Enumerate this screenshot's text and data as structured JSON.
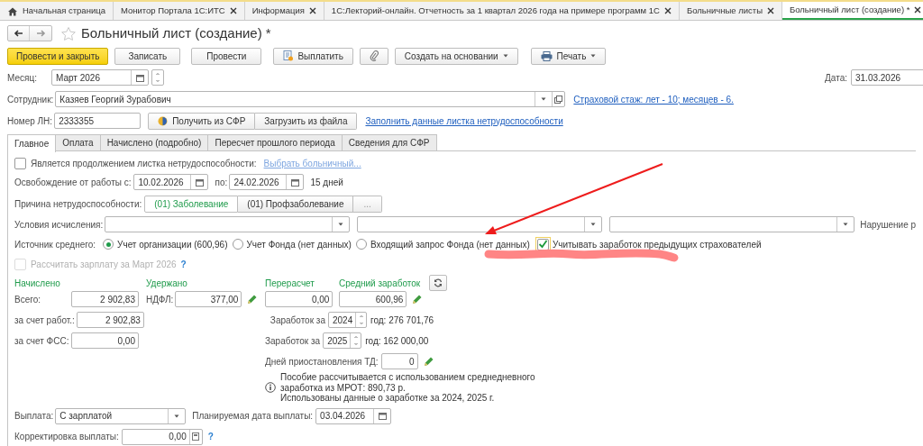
{
  "open_tabs": [
    {
      "kind": "home",
      "label": "Начальная страница",
      "closable": false,
      "selected": false
    },
    {
      "kind": "doc",
      "label": "Монитор Портала 1С:ИТС",
      "closable": true,
      "selected": false
    },
    {
      "kind": "doc",
      "label": "Информация",
      "closable": true,
      "selected": false
    },
    {
      "kind": "doc",
      "label": "1С:Лекторий-онлайн. Отчетность за 1 квартал 2026 года на примере программ 1С",
      "closable": true,
      "selected": false
    },
    {
      "kind": "doc",
      "label": "Больничные листы",
      "closable": true,
      "selected": false
    },
    {
      "kind": "doc",
      "label": "Больничный лист (создание) *",
      "closable": true,
      "selected": true
    }
  ],
  "title": "Больничный лист (создание) *",
  "toolbar": [
    {
      "kind": "primary",
      "label": "Провести и закрыть"
    },
    {
      "kind": "plain",
      "label": "Записать"
    },
    {
      "kind": "plain",
      "label": "Провести"
    },
    {
      "kind": "pay",
      "label": "Выплатить"
    },
    {
      "kind": "attach"
    },
    {
      "kind": "menu",
      "label": "Создать на основании"
    },
    {
      "kind": "print",
      "label": "Печать"
    }
  ],
  "month": {
    "label": "Месяц:",
    "value": "Март 2026"
  },
  "date": {
    "label": "Дата:",
    "value": "31.03.2026"
  },
  "employee": {
    "label": "Сотрудник:",
    "value": "Казяев Георгий Зурабович",
    "link": "Страховой стаж: лет - 10; месяцев - 6."
  },
  "sick_leave_number": {
    "label": "Номер ЛН:",
    "value": "2333355",
    "buttons": [
      {
        "kind": "sfr",
        "label": "Получить из СФР"
      },
      {
        "kind": "plain",
        "label": "Загрузить из файла"
      }
    ],
    "link": "Заполнить данные листка нетрудоспособности"
  },
  "form_tabs": [
    {
      "label": "Главное",
      "selected": true
    },
    {
      "label": "Оплата",
      "selected": false
    },
    {
      "label": "Начислено (подробно)",
      "selected": false
    },
    {
      "label": "Пересчет прошлого периода",
      "selected": false
    },
    {
      "label": "Сведения для СФР",
      "selected": false
    }
  ],
  "continuation": {
    "label": "Является продолжением листка нетрудоспособности:",
    "checked": false,
    "link": "Выбрать больничный..."
  },
  "release": {
    "label": "Освобождение от работы с:",
    "from": "10.02.2026",
    "to_label": "по:",
    "to": "24.02.2026",
    "duration": "15 дней"
  },
  "reason": {
    "label": "Причина нетрудоспособности:",
    "options": [
      {
        "label": "(01) Заболевание",
        "selected": true
      },
      {
        "label": "(01) Профзаболевание",
        "selected": false
      }
    ],
    "more": "..."
  },
  "conditions": {
    "label": "Условия исчисления:",
    "violation_label": "Нарушение р"
  },
  "average_source": {
    "label": "Источник среднего:",
    "options": [
      {
        "label": "Учет организации (600,96)",
        "selected": true
      },
      {
        "label": "Учет Фонда (нет данных)",
        "selected": false
      },
      {
        "label": "Входящий запрос Фонда (нет данных)",
        "selected": false
      }
    ]
  },
  "previous_insurers": {
    "label": "Учитывать заработок предыдущих страхователей",
    "checked": true,
    "focused": true
  },
  "recalc_salary": {
    "label": "Рассчитать зарплату за Март 2026",
    "checked": false,
    "disabled": true,
    "help": "?"
  },
  "accrued": {
    "title": "Начислено",
    "rows": [
      {
        "label": "Всего:",
        "value": "2 902,83"
      },
      {
        "label": "за счет работ.:",
        "value": "2 902,83"
      },
      {
        "label": "за счет ФСС:",
        "value": "0,00"
      }
    ]
  },
  "withheld": {
    "title": "Удержано",
    "label": "НДФЛ:",
    "value": "377,00"
  },
  "recalculation": {
    "title": "Перерасчет",
    "value": "0,00"
  },
  "average_earnings": {
    "title": "Средний заработок",
    "value": "600,96"
  },
  "earnings": [
    {
      "label": "Заработок за",
      "year": "2024",
      "amount": "год: 276 701,76"
    },
    {
      "label": "Заработок за",
      "year": "2025",
      "amount": "год: 162 000,00"
    }
  ],
  "suspension": {
    "label": "Дней приостановления ТД:",
    "value": "0"
  },
  "note": [
    "Пособие рассчитывается с использованием среднедневного",
    "заработка из МРОТ: 890,73 р.",
    "Использованы данные о заработке за  2024,  2025 г."
  ],
  "payment": {
    "label": "Выплата:",
    "value": "С зарплатой",
    "date_label": "Планируемая дата выплаты:",
    "date": "03.04.2026"
  },
  "correction": {
    "label": "Корректировка выплаты:",
    "value": "0,00",
    "help": "?"
  }
}
